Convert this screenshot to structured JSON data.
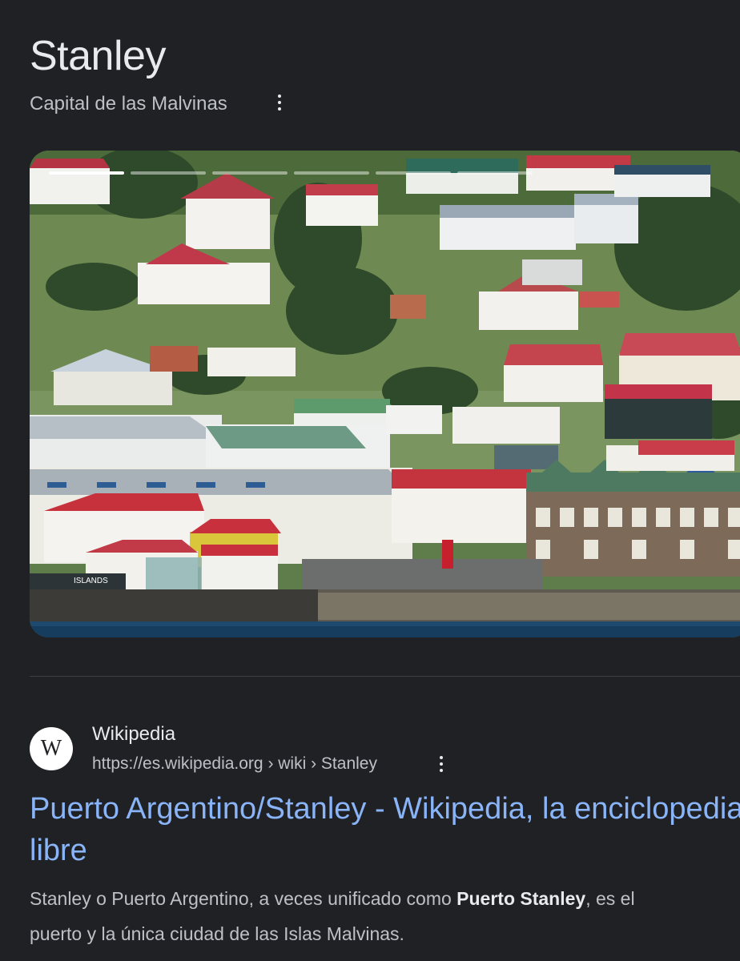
{
  "entity": {
    "title": "Stanley",
    "subtitle": "Capital de las Malvinas"
  },
  "hero_image": {
    "slides": 6,
    "active_slide": 1,
    "watermark": "ISLANDS"
  },
  "result": {
    "favicon": "W",
    "site_name": "Wikipedia",
    "url": "https://es.wikipedia.org › wiki › Stanley",
    "title_line1": "Puerto Argentino/Stanley - Wikipedia, la enciclopedia",
    "title_line2": "libre",
    "snippet_part1": "Stanley o Puerto Argentino, a veces unificado como ",
    "snippet_bold": "Puerto Stanley",
    "snippet_part2": ", es el",
    "snippet_line2": "puerto y la única ciudad de las Islas Malvinas."
  },
  "colors": {
    "background": "#202124",
    "link": "#8ab4f8",
    "text_secondary": "#bdc1c6"
  },
  "icons": [
    "more-vert-icon",
    "wikipedia-favicon"
  ]
}
